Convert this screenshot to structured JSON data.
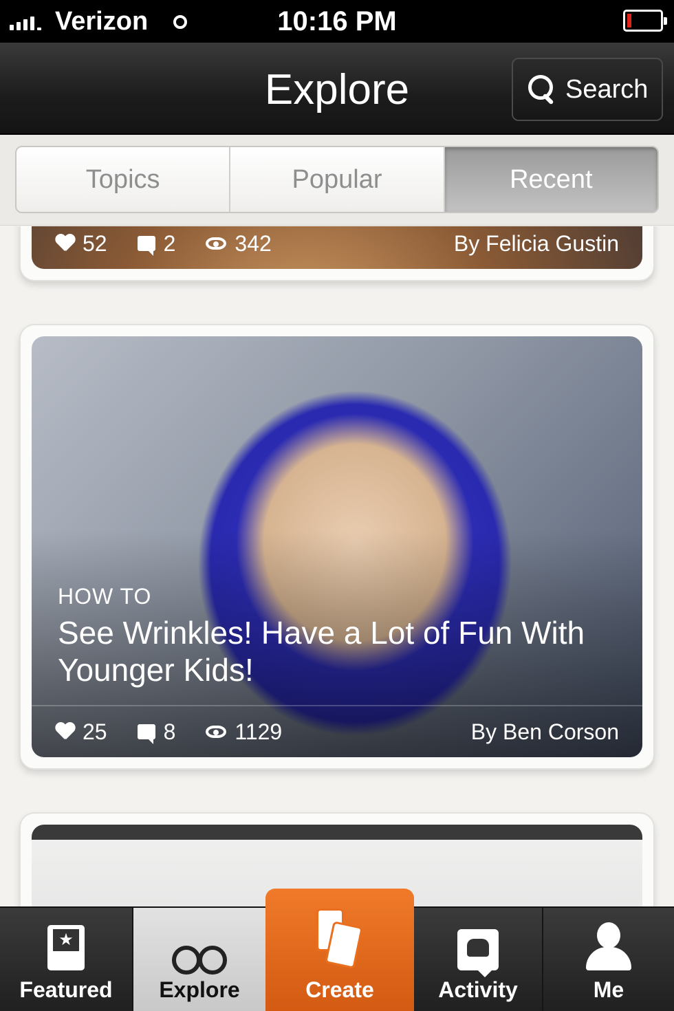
{
  "status_bar": {
    "carrier": "Verizon",
    "time": "10:16 PM"
  },
  "nav": {
    "title": "Explore",
    "search_label": "Search"
  },
  "segments": [
    {
      "label": "Topics",
      "active": false
    },
    {
      "label": "Popular",
      "active": false
    },
    {
      "label": "Recent",
      "active": true
    }
  ],
  "feed": [
    {
      "likes": "52",
      "comments": "2",
      "views": "342",
      "author": "By Felicia Gustin"
    },
    {
      "kicker": "HOW TO",
      "title": "See Wrinkles! Have a Lot of Fun With Younger Kids!",
      "likes": "25",
      "comments": "8",
      "views": "1129",
      "author": "By Ben Corson"
    }
  ],
  "tab_bar": {
    "items": [
      {
        "label": "Featured",
        "icon": "featured-icon"
      },
      {
        "label": "Explore",
        "icon": "binoculars-icon",
        "selected": true
      },
      {
        "label": "Create",
        "icon": "create-icon"
      },
      {
        "label": "Activity",
        "icon": "activity-icon"
      },
      {
        "label": "Me",
        "icon": "person-icon"
      }
    ]
  },
  "colors": {
    "accent": "#e8661a",
    "battery_low": "#e0221b"
  }
}
